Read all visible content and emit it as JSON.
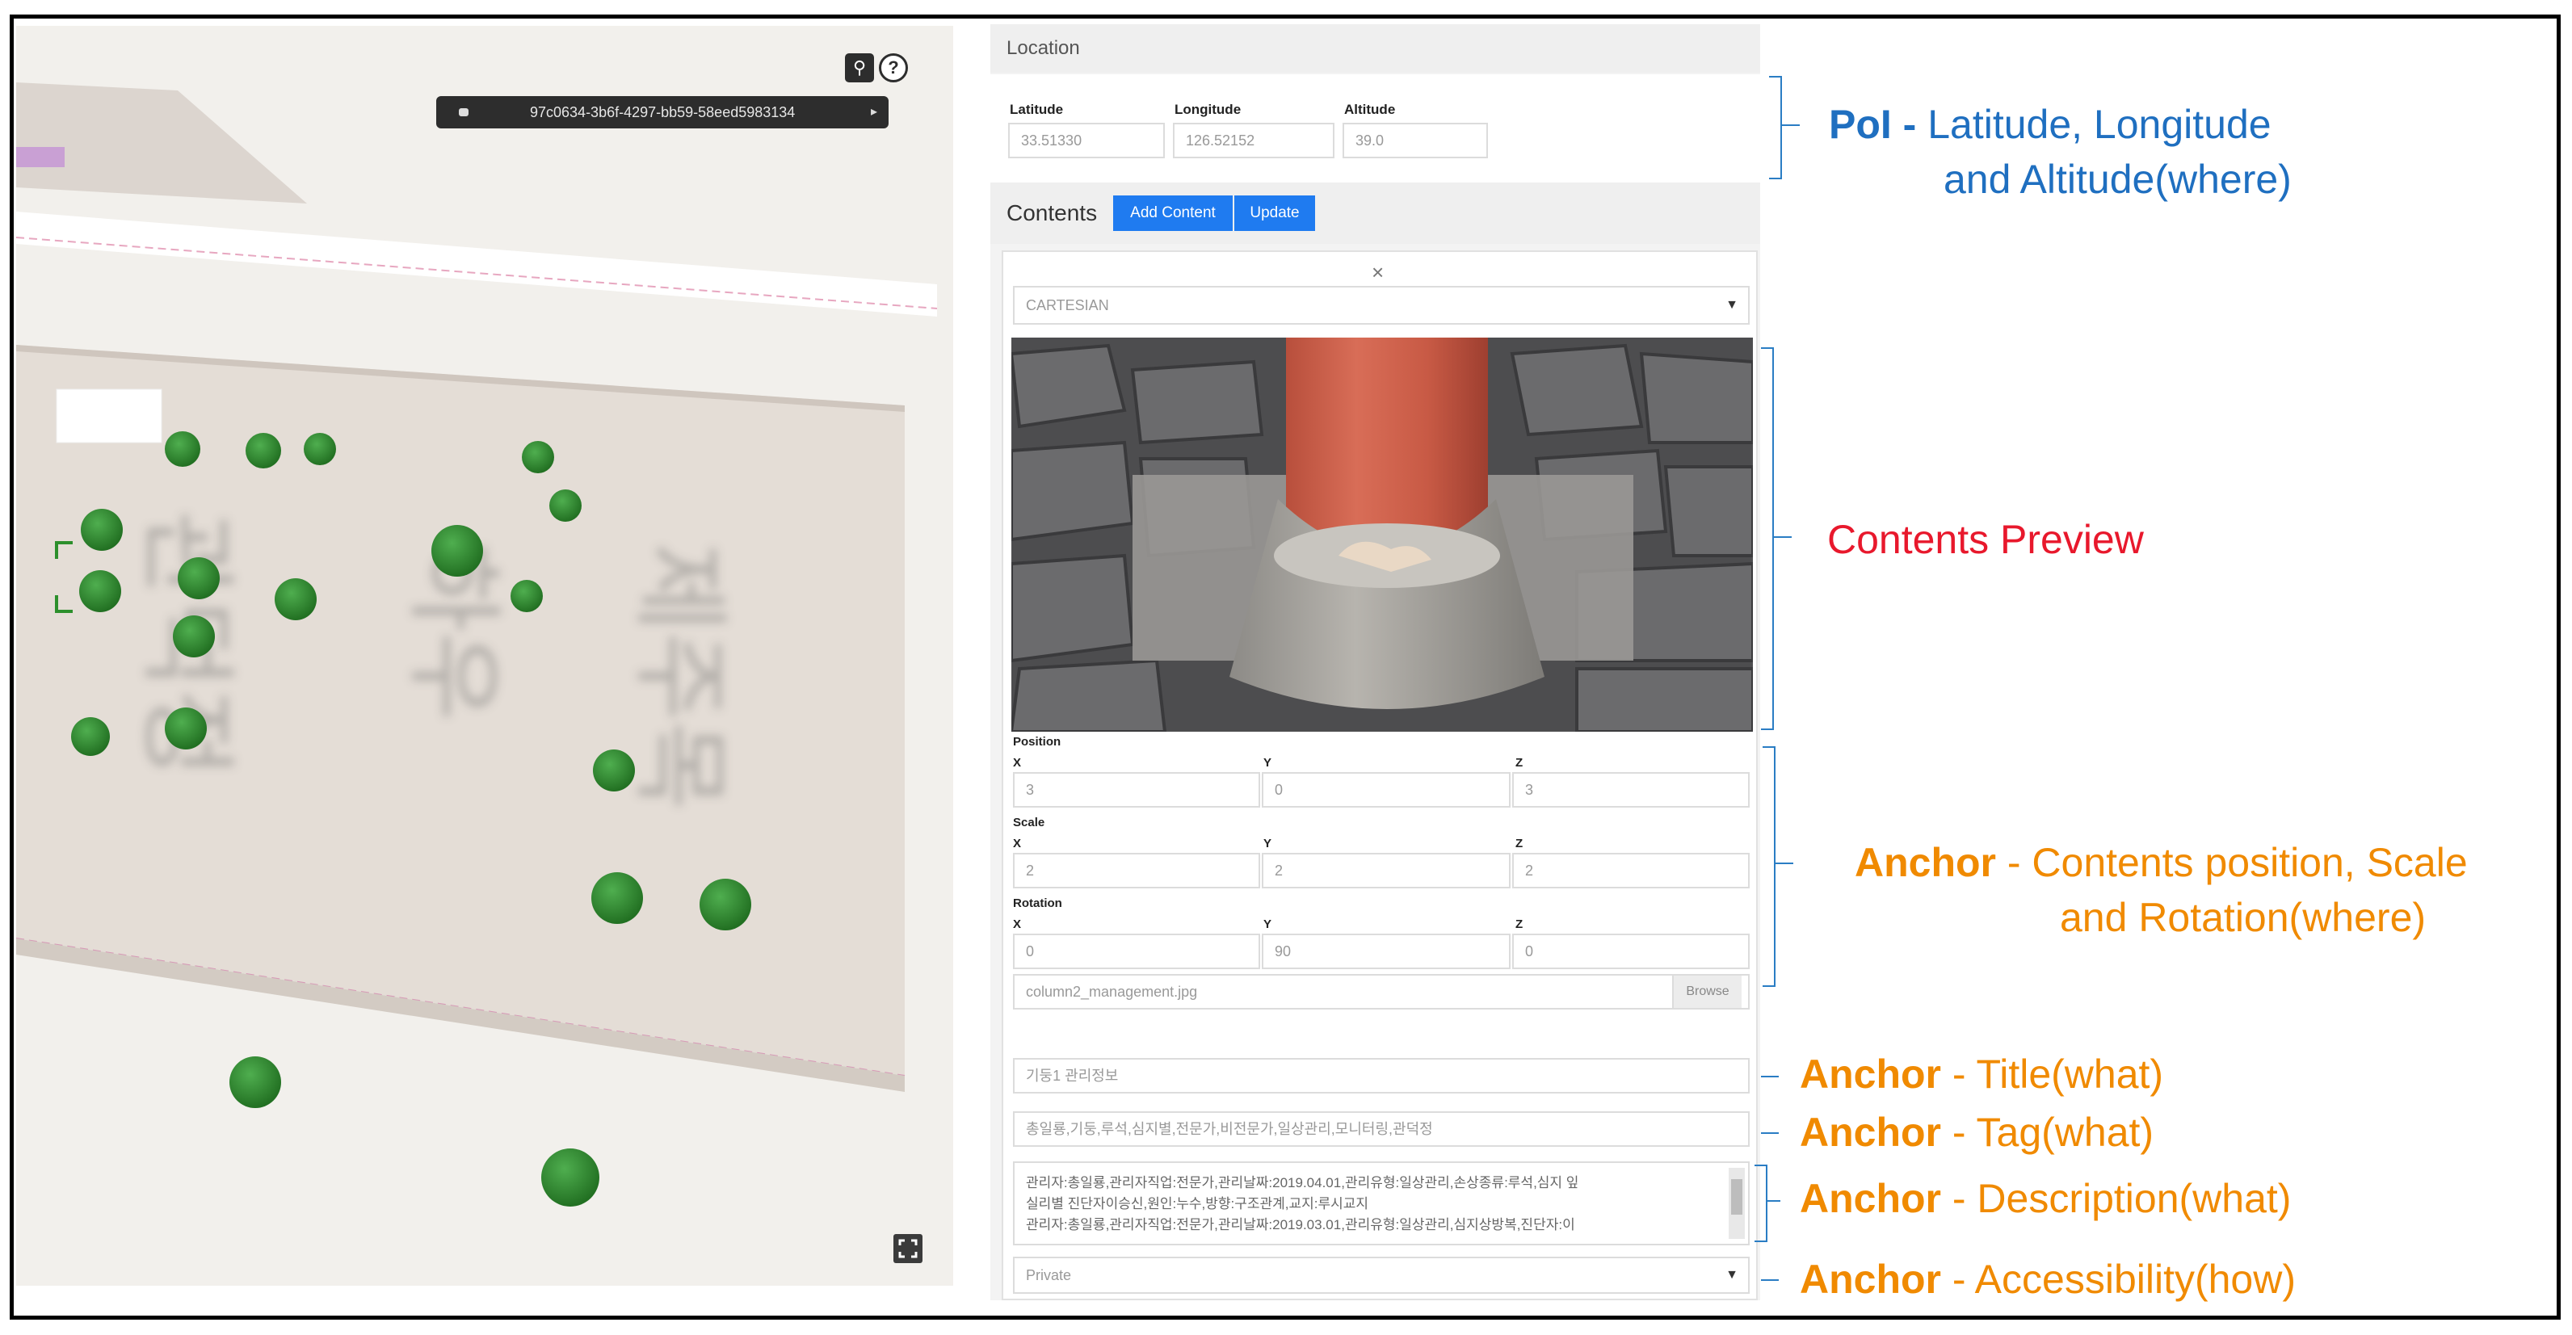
{
  "viewer": {
    "entity_id": "97c0634-3b6f-4297-bb59-58eed5983134",
    "map_text": [
      "관덕정",
      "하우",
      "제주목"
    ],
    "toolbar": {
      "search_icon": "magnifier",
      "help_icon": "question-mark",
      "fullscreen_icon": "expand"
    }
  },
  "panel": {
    "location": {
      "heading": "Location",
      "latitude_label": "Latitude",
      "latitude_value": "33.51330",
      "longitude_label": "Longitude",
      "longitude_value": "126.52152",
      "altitude_label": "Altitude",
      "altitude_value": "39.0"
    },
    "contents": {
      "heading": "Contents",
      "add_content_label": "Add Content",
      "update_label": "Update",
      "close_symbol": "×",
      "type_select": "CARTESIAN",
      "position": {
        "label": "Position",
        "x_label": "X",
        "x": "3",
        "y_label": "Y",
        "y": "0",
        "z_label": "Z",
        "z": "3"
      },
      "scale": {
        "label": "Scale",
        "x_label": "X",
        "x": "2",
        "y_label": "Y",
        "y": "2",
        "z_label": "Z",
        "z": "2"
      },
      "rotation": {
        "label": "Rotation",
        "x_label": "X",
        "x": "0",
        "y_label": "Y",
        "y": "90",
        "z_label": "Z",
        "z": "0"
      },
      "file_name": "column2_management.jpg",
      "browse_label": "Browse",
      "title_value": "기둥1 관리정보",
      "tag_value": "총일룡,기둥,루석,심지별,전문가,비전문가,일상관리,모니터링,관덕정",
      "description_lines": [
        "관리자:총일룡,관리자직업:전문가,관리날짜:2019.04.01,관리유형:일상관리,손상종류:루석,심지 잎",
        "실리별 진단자이승신,원인:누수,방향:구조관계,교지:루시교지",
        "관리자:총일룡,관리자직업:전문가,관리날짜:2019.03.01,관리유형:일상관리,심지상방복,진단자:이"
      ],
      "accessibility_select": "Private"
    }
  },
  "annotations": {
    "poi": {
      "key": "PoI -",
      "text_line1": " Latitude, Longitude",
      "text_line2": "and Altitude(where)"
    },
    "preview": {
      "text": "Contents Preview"
    },
    "anchor_transform": {
      "key": "Anchor",
      "text_line1": " - Contents position, Scale",
      "text_line2": "and Rotation(where)"
    },
    "anchor_title": {
      "key": "Anchor",
      "text": " - Title(what)"
    },
    "anchor_tag": {
      "key": "Anchor",
      "text": " - Tag(what)"
    },
    "anchor_description": {
      "key": "Anchor",
      "text": " - Description(what)"
    },
    "anchor_accessibility": {
      "key": "Anchor",
      "text": " - Accessibility(how)"
    }
  },
  "colors": {
    "poi_blue": "#1f6fc0",
    "preview_red": "#e8182c",
    "anchor_orange": "#f08a00",
    "button_blue": "#1f7bf0",
    "tree_green": "#2f8a2f"
  }
}
